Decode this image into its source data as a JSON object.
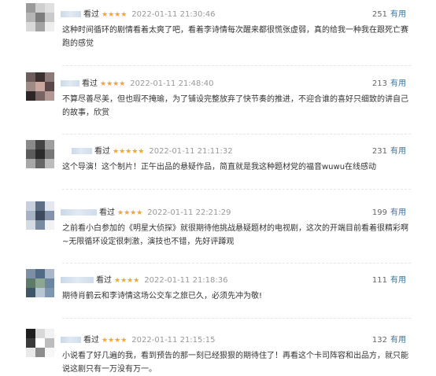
{
  "comments": [
    {
      "status": "看过",
      "stars": "★★★★",
      "time": "2022-01-11 21:30:46",
      "votes": "251",
      "vote_label": "有用",
      "text": "这种时间循环的剧情看着太爽了吧，看着李诗情每次醒来都很慌张虚弱，真的给我一种我在跟死亡赛跑的感觉"
    },
    {
      "status": "看过",
      "stars": "★★★★",
      "time": "2022-01-11 21:48:40",
      "votes": "213",
      "vote_label": "有用",
      "text": "不算尽善尽美，但也瑕不掩瑜，为了铺设完整放弃了快节奏的推进，不迎合谁的喜好只细致的讲自己的故事，欣赏"
    },
    {
      "status": "看过",
      "stars": "★★★★★",
      "time": "2022-01-11 21:11:32",
      "votes": "231",
      "vote_label": "有用",
      "text": "这个导演！这个制片！正午出品的悬疑作品，简直就是我这种题材党的福音wuwu在线感动"
    },
    {
      "status": "看过",
      "stars": "★★★★",
      "time": "2022-01-11 22:21:29",
      "votes": "199",
      "vote_label": "有用",
      "text": "之前看小白参加的《明星大侦探》就很期待他挑战悬疑题材的电视剧，这次的开端目前看着很精彩啊~无限循环设定很刺激，演技也不错，先好评蹲观"
    },
    {
      "status": "看过",
      "stars": "★★★★",
      "time": "2022-01-11 21:18:36",
      "votes": "111",
      "vote_label": "有用",
      "text": "期待肖鹤云和李诗情这场公交车之旅已久，必须先冲为敬!"
    },
    {
      "status": "看过",
      "stars": "★★★★",
      "time": "2022-01-11 21:15:15",
      "votes": "132",
      "vote_label": "有用",
      "text": "小说看了好几遍的我，看到预告的那一刻已经狠狠的期待住了！再看这个卡司阵容和出品方，就只能说这剧只有一万没有万一。"
    }
  ],
  "colors": {
    "star": "#f5a623",
    "link": "#3377aa",
    "time": "#999999",
    "text": "#333333"
  }
}
